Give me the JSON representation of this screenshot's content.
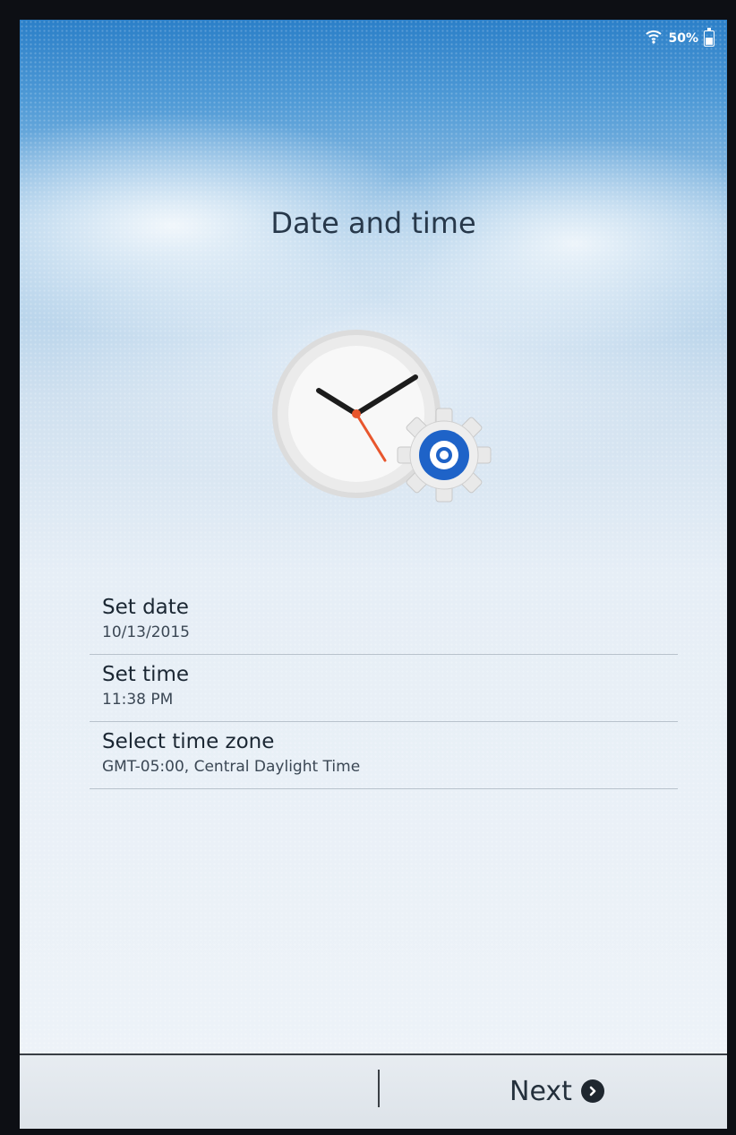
{
  "status_bar": {
    "wifi_icon": "wifi-icon",
    "battery_text": "50%",
    "battery_icon": "battery-icon",
    "battery_level": 0.5
  },
  "page": {
    "title": "Date and time"
  },
  "illustration": {
    "clock_icon": "clock-icon",
    "gear_icon": "gear-icon",
    "accent_color": "#1e63c8"
  },
  "settings": [
    {
      "label": "Set date",
      "value": "10/13/2015"
    },
    {
      "label": "Set time",
      "value": "11:38 PM"
    },
    {
      "label": "Select time zone",
      "value": "GMT-05:00, Central Daylight Time"
    }
  ],
  "footer": {
    "next_label": "Next",
    "next_icon": "chevron-right-circle-icon"
  }
}
